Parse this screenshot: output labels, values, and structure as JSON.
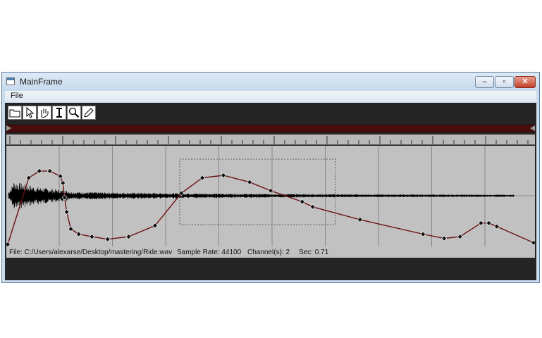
{
  "window": {
    "title": "MainFrame"
  },
  "menu": {
    "file": "File"
  },
  "toolbar": {
    "tools": [
      {
        "name": "open-folder-icon"
      },
      {
        "name": "select-arrow-icon"
      },
      {
        "name": "hand-pan-icon"
      },
      {
        "name": "text-cursor-icon"
      },
      {
        "name": "zoom-magnifier-icon"
      },
      {
        "name": "pencil-icon"
      }
    ]
  },
  "status": {
    "file": "File: C:/Users/alexarse/Desktop/mastering/Ride.wav",
    "sample_rate": "Sample Rate: 44100",
    "channels": "Channel(s): 2",
    "seconds": "Sec: 0.71"
  },
  "envelope": {
    "points": [
      [
        0.0,
        0.0
      ],
      [
        0.04,
        0.78
      ],
      [
        0.06,
        0.86
      ],
      [
        0.08,
        0.86
      ],
      [
        0.1,
        0.8
      ],
      [
        0.105,
        0.72
      ],
      [
        0.108,
        0.55
      ],
      [
        0.112,
        0.38
      ],
      [
        0.12,
        0.18
      ],
      [
        0.135,
        0.12
      ],
      [
        0.16,
        0.09
      ],
      [
        0.19,
        0.06
      ],
      [
        0.23,
        0.09
      ],
      [
        0.28,
        0.22
      ],
      [
        0.33,
        0.6
      ],
      [
        0.37,
        0.78
      ],
      [
        0.41,
        0.81
      ],
      [
        0.46,
        0.73
      ],
      [
        0.5,
        0.63
      ],
      [
        0.56,
        0.5
      ],
      [
        0.58,
        0.44
      ],
      [
        0.67,
        0.29
      ],
      [
        0.79,
        0.12
      ],
      [
        0.83,
        0.07
      ],
      [
        0.86,
        0.09
      ],
      [
        0.9,
        0.25
      ],
      [
        0.915,
        0.25
      ],
      [
        0.93,
        0.21
      ],
      [
        1.0,
        0.02
      ]
    ]
  },
  "colors": {
    "envelope": "#6b1010",
    "waveform": "#000000",
    "background": "#c1c1c1"
  }
}
